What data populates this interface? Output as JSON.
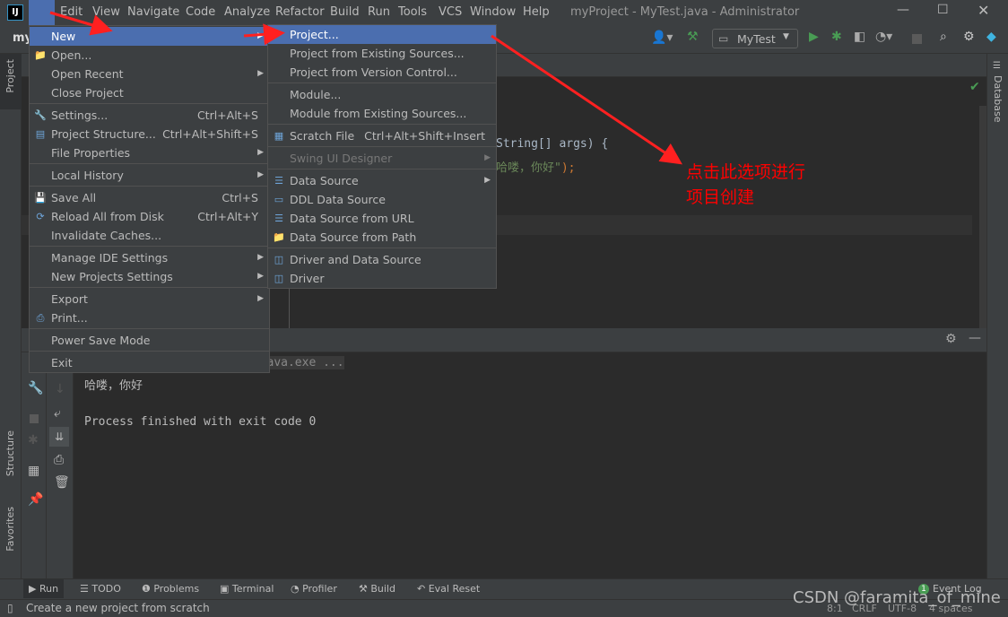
{
  "app": {
    "title": "myProject - MyTest.java - Administrator",
    "logo": "IJ",
    "project_crumb": "my"
  },
  "menubar": [
    "File",
    "Edit",
    "View",
    "Navigate",
    "Code",
    "Analyze",
    "Refactor",
    "Build",
    "Run",
    "Tools",
    "VCS",
    "Window",
    "Help"
  ],
  "toolbar": {
    "run_config": "MyTest"
  },
  "file_menu": [
    {
      "label": "New",
      "arrow": true,
      "selected": true
    },
    {
      "label": "Open...",
      "icon": "folder-icon"
    },
    {
      "label": "Open Recent",
      "arrow": true
    },
    {
      "label": "Close Project"
    },
    {
      "sep": true
    },
    {
      "label": "Settings...",
      "shortcut": "Ctrl+Alt+S",
      "icon": "wrench-icon"
    },
    {
      "label": "Project Structure...",
      "shortcut": "Ctrl+Alt+Shift+S",
      "icon": "project-structure-icon"
    },
    {
      "label": "File Properties",
      "arrow": true
    },
    {
      "sep": true
    },
    {
      "label": "Local History",
      "arrow": true
    },
    {
      "sep": true
    },
    {
      "label": "Save All",
      "shortcut": "Ctrl+S",
      "icon": "save-icon"
    },
    {
      "label": "Reload All from Disk",
      "shortcut": "Ctrl+Alt+Y",
      "icon": "reload-icon"
    },
    {
      "label": "Invalidate Caches..."
    },
    {
      "sep": true
    },
    {
      "label": "Manage IDE Settings",
      "arrow": true
    },
    {
      "label": "New Projects Settings",
      "arrow": true
    },
    {
      "sep": true
    },
    {
      "label": "Export",
      "arrow": true
    },
    {
      "label": "Print...",
      "icon": "print-icon"
    },
    {
      "sep": true
    },
    {
      "label": "Power Save Mode"
    },
    {
      "sep": true
    },
    {
      "label": "Exit"
    }
  ],
  "new_submenu": [
    {
      "label": "Project...",
      "selected": true
    },
    {
      "label": "Project from Existing Sources..."
    },
    {
      "label": "Project from Version Control..."
    },
    {
      "sep": true
    },
    {
      "label": "Module..."
    },
    {
      "label": "Module from Existing Sources..."
    },
    {
      "sep": true
    },
    {
      "label": "Scratch File",
      "shortcut": "Ctrl+Alt+Shift+Insert",
      "icon": "scratch-file-icon"
    },
    {
      "sep": true
    },
    {
      "label": "Swing UI Designer",
      "arrow": true,
      "disabled": true
    },
    {
      "sep": true
    },
    {
      "label": "Data Source",
      "arrow": true,
      "icon": "database-icon"
    },
    {
      "label": "DDL Data Source",
      "icon": "ddl-icon"
    },
    {
      "label": "Data Source from URL",
      "icon": "database-url-icon"
    },
    {
      "label": "Data Source from Path",
      "icon": "folder-icon"
    },
    {
      "sep": true
    },
    {
      "label": "Driver and Data Source",
      "icon": "driver-icon"
    },
    {
      "label": "Driver",
      "icon": "driver-icon"
    }
  ],
  "editor": {
    "line1": "String[] args) {",
    "line2_str": "哈喽，你好\"",
    "line2_end": ");"
  },
  "annotation": {
    "line1": "点击此选项进行",
    "line2": "项目创建",
    "color": "#ff0000"
  },
  "console": {
    "cmd": "D:\\Java\\jdk1.8.0_201\\bin\\java.exe ...",
    "out": "哈喽，你好",
    "exit": "Process finished with exit code 0"
  },
  "side": {
    "project": "Project",
    "structure": "Structure",
    "favorites": "Favorites",
    "database": "Database"
  },
  "bottom_tabs": [
    "Run",
    "TODO",
    "Problems",
    "Terminal",
    "Profiler",
    "Build",
    "Eval Reset"
  ],
  "event_log": {
    "count": "1",
    "label": "Event Log"
  },
  "status": {
    "message": "Create a new project from scratch",
    "position": "8:1",
    "line_sep": "CRLF",
    "encoding": "UTF-8",
    "indent": "4 spaces"
  },
  "watermark": "CSDN @faramita_of_mine",
  "colors": {
    "selection": "#4b6eaf",
    "menu_bg": "#3c3f41",
    "editor_bg": "#2b2b2b",
    "run_green": "#499c54"
  }
}
